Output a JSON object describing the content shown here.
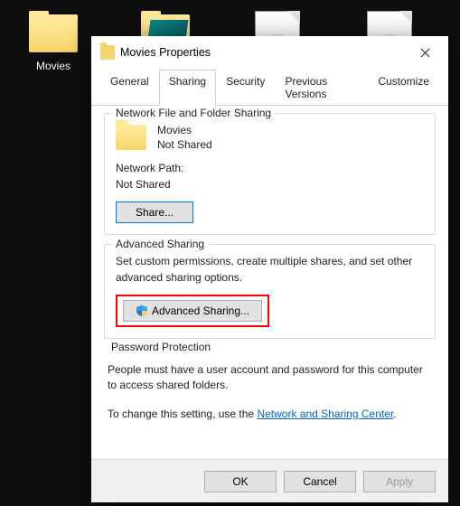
{
  "desktop": {
    "items": [
      {
        "label": "Movies",
        "kind": "folder"
      },
      {
        "label": "",
        "kind": "folder-art"
      },
      {
        "label": "",
        "kind": "disc-file"
      },
      {
        "label": "",
        "kind": "disc-file"
      }
    ]
  },
  "dialog": {
    "title": "Movies Properties",
    "tabs": [
      {
        "label": "General"
      },
      {
        "label": "Sharing"
      },
      {
        "label": "Security"
      },
      {
        "label": "Previous Versions"
      },
      {
        "label": "Customize"
      }
    ],
    "active_tab_index": 1,
    "network_sharing": {
      "group_title": "Network File and Folder Sharing",
      "item_name": "Movies",
      "item_status": "Not Shared",
      "network_path_label": "Network Path:",
      "network_path_value": "Not Shared",
      "share_button": "Share..."
    },
    "advanced_sharing": {
      "group_title": "Advanced Sharing",
      "description": "Set custom permissions, create multiple shares, and set other advanced sharing options.",
      "button": "Advanced Sharing..."
    },
    "password_protection": {
      "group_title": "Password Protection",
      "line1": "People must have a user account and password for this computer to access shared folders.",
      "line2_prefix": "To change this setting, use the ",
      "link_text": "Network and Sharing Center",
      "line2_suffix": "."
    },
    "footer": {
      "ok": "OK",
      "cancel": "Cancel",
      "apply": "Apply"
    }
  }
}
